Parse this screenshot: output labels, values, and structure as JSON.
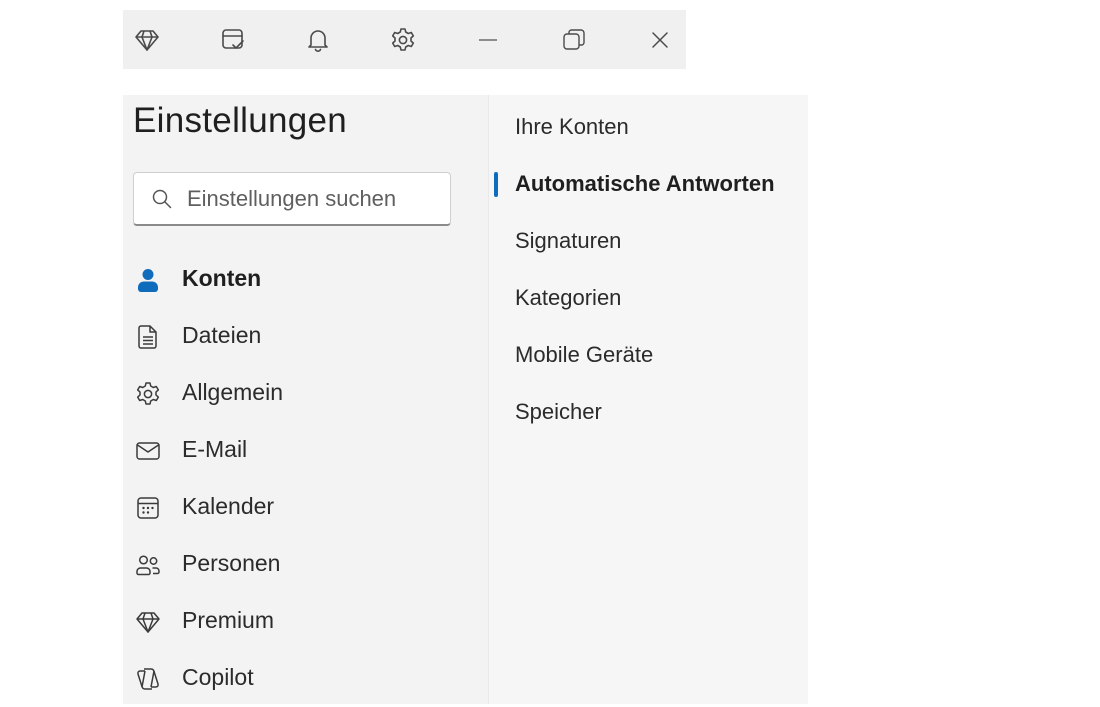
{
  "toolbar": {
    "buttons": [
      {
        "icon": "diamond-icon"
      },
      {
        "icon": "note-check-icon"
      },
      {
        "icon": "bell-icon"
      },
      {
        "icon": "gear-icon"
      },
      {
        "icon": "minimize-icon"
      },
      {
        "icon": "restore-icon"
      },
      {
        "icon": "close-icon"
      }
    ]
  },
  "settings": {
    "title": "Einstellungen",
    "search": {
      "placeholder": "Einstellungen suchen",
      "value": ""
    },
    "nav": [
      {
        "label": "Konten",
        "icon": "person-icon",
        "active": true
      },
      {
        "label": "Dateien",
        "icon": "document-icon",
        "active": false
      },
      {
        "label": "Allgemein",
        "icon": "gear-icon",
        "active": false
      },
      {
        "label": "E-Mail",
        "icon": "mail-icon",
        "active": false
      },
      {
        "label": "Kalender",
        "icon": "calendar-icon",
        "active": false
      },
      {
        "label": "Personen",
        "icon": "people-icon",
        "active": false
      },
      {
        "label": "Premium",
        "icon": "diamond-icon",
        "active": false
      },
      {
        "label": "Copilot",
        "icon": "copilot-icon",
        "active": false
      }
    ],
    "subnav": [
      {
        "label": "Ihre Konten",
        "active": false
      },
      {
        "label": "Automatische Antworten",
        "active": true
      },
      {
        "label": "Signaturen",
        "active": false
      },
      {
        "label": "Kategorien",
        "active": false
      },
      {
        "label": "Mobile Geräte",
        "active": false
      },
      {
        "label": "Speicher",
        "active": false
      }
    ]
  },
  "colors": {
    "accent": "#0f6cbd",
    "panel_bg": "#f3f3f3",
    "toolbar_bg": "#f0f0f0"
  }
}
